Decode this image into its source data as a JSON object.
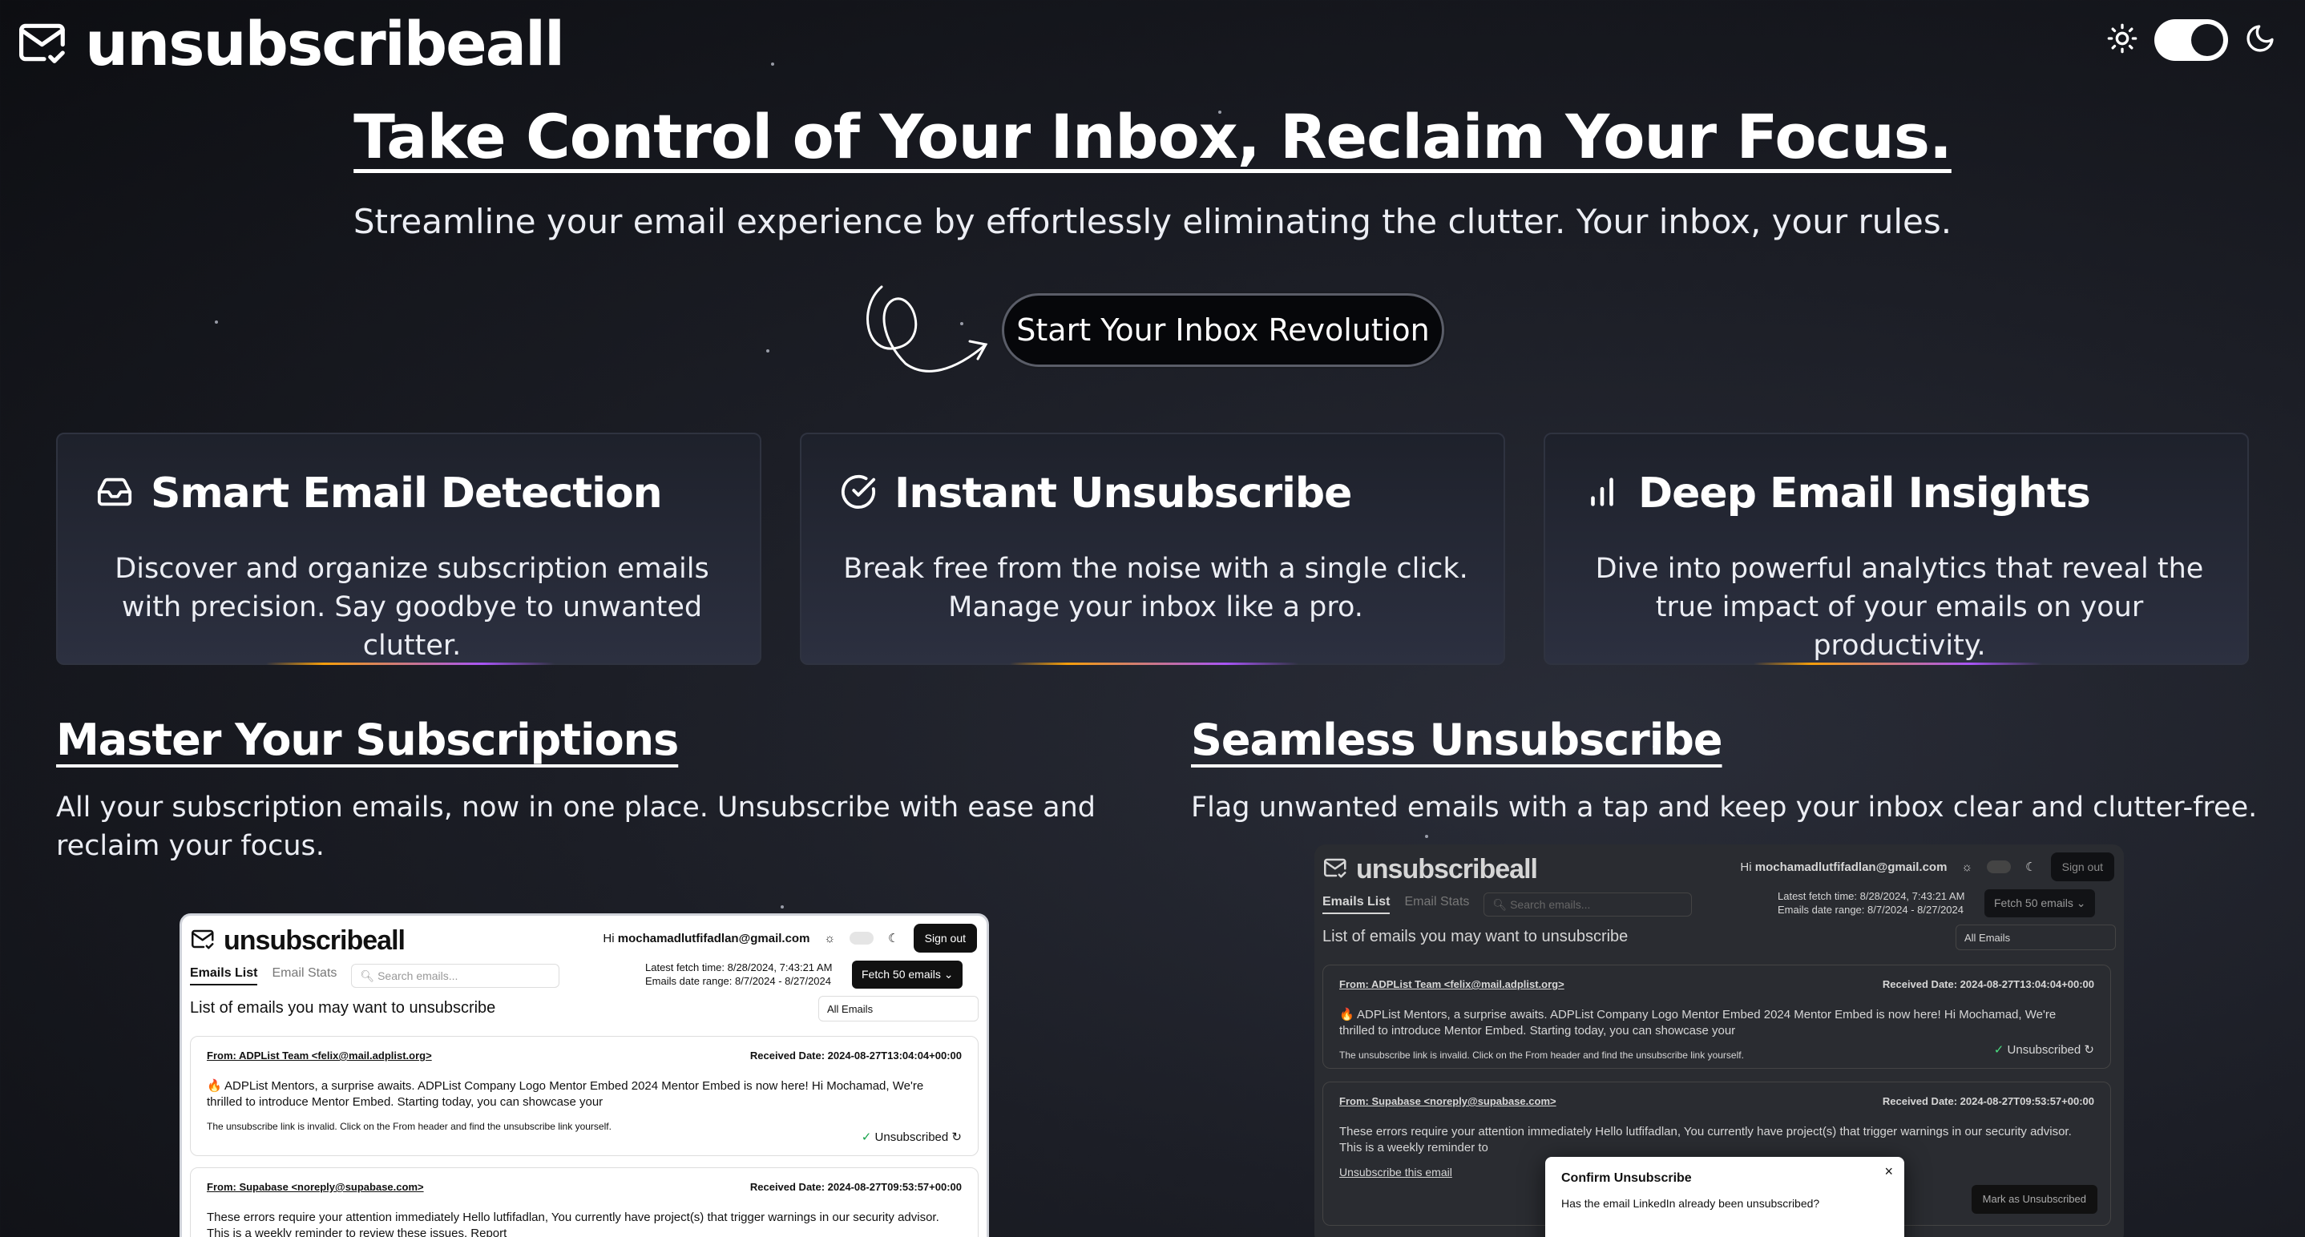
{
  "header": {
    "logo_text": "unsubscribeall",
    "icons": {
      "logo": "mail-check-icon",
      "light": "sun-icon",
      "dark": "moon-icon"
    }
  },
  "hero": {
    "title": "Take Control of Your Inbox, Reclaim Your Focus.",
    "subtitle": "Streamline your email experience by effortlessly eliminating the clutter. Your inbox, your rules.",
    "cta_label": "Start Your Inbox Revolution"
  },
  "features": [
    {
      "icon": "inbox-icon",
      "title": "Smart Email Detection",
      "desc": "Discover and organize subscription emails with precision. Say goodbye to unwanted clutter."
    },
    {
      "icon": "check-circle-icon",
      "title": "Instant Unsubscribe",
      "desc": "Break free from the noise with a single click. Manage your inbox like a pro."
    },
    {
      "icon": "bar-chart-icon",
      "title": "Deep Email Insights",
      "desc": "Dive into powerful analytics that reveal the true impact of your emails on your productivity."
    }
  ],
  "sections": {
    "left": {
      "title": "Master Your Subscriptions",
      "desc": "All your subscription emails, now in one place. Unsubscribe with ease and reclaim your focus."
    },
    "right": {
      "title": "Seamless Unsubscribe",
      "desc": "Flag unwanted emails with a tap and keep your inbox clear and clutter-free."
    }
  },
  "mockup": {
    "logo": "unsubscribeall",
    "greeting": "Hi",
    "user_email": "mochamadlutfifadlan@gmail.com",
    "sign_out": "Sign out",
    "tab_list": "Emails List",
    "tab_stats": "Email Stats",
    "search_placeholder": "Search emails...",
    "fetch_time": "Latest fetch time: 8/28/2024, 7:43:21 AM",
    "date_range": "Emails date range: 8/7/2024 - 8/27/2024",
    "fetch_button": "Fetch 50 emails",
    "list_title": "List of emails you may want to unsubscribe",
    "filter": "All Emails",
    "email1": {
      "from": "From: ADPList Team <felix@mail.adplist.org>",
      "date": "Received Date: 2024-08-27T13:04:04+00:00",
      "body": "🔥 ADPList Mentors, a surprise awaits. ADPList Company Logo Mentor Embed 2024 Mentor Embed is now here! Hi Mochamad, We're thrilled to introduce Mentor Embed. Starting today, you can showcase your",
      "note": "The unsubscribe link is invalid. Click on the From header and find the unsubscribe link yourself.",
      "status": "Unsubscribed"
    },
    "email2": {
      "from": "From: Supabase <noreply@supabase.com>",
      "date": "Received Date: 2024-08-27T09:53:57+00:00",
      "body": "These errors require your attention immediately Hello lutfifadlan, You currently have project(s) that trigger warnings in our security advisor. This is a weekly reminder to review these issues. Report",
      "body_short": "These errors require your attention immediately Hello lutfifadlan, You currently have project(s) that trigger warnings in our security advisor. This is a weekly reminder to",
      "link": "Unsubscribe this email",
      "mark": "Mark as Unsubscribed"
    },
    "dialog": {
      "title": "Confirm Unsubscribe",
      "text": "Has the email LinkedIn already been unsubscribed?"
    }
  }
}
